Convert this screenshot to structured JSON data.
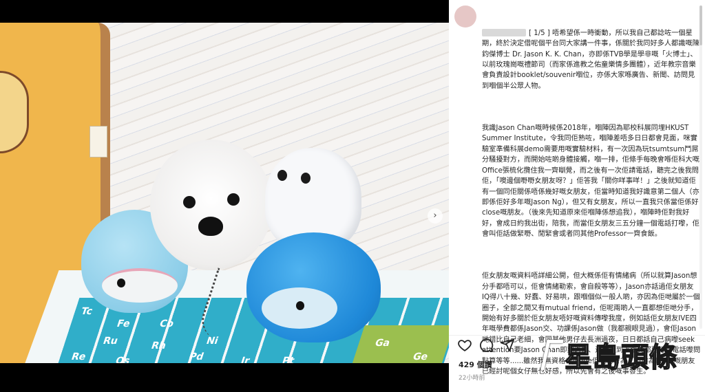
{
  "post": {
    "caption_paragraphs": [
      "[ 1/5 ] 唔希望係一時衝動，所以我自己都諗咗一個星期，終於決定借呢個平台同大家講一件事，係關於我同好多人都識嘅陳鈞傑博士 Dr. Jason K. K. Chan，亦即係TVB學是學非嘅「火博士」、以前玫瑰崗嘅禮節司（而家係進教之佑童樂情多團體），近年教宗音樂會負責設計booklet/souvenir嗰位，亦係大家喺廣告、新聞、訪問見到嗰個半公眾人物。",
      "我識Jason Chan嘅時候係2018年，嗰陣因為耶校科展同埋HKUST Summer Institute，令我同佢熟咗，嗰陣差唔多日日都會見面，咪實驗室準備科展demo需要用嘅實驗材料，有一次因為玩tsumtsum鬥屌分騷擾對方，而開始咗啲身體接觸，嗰一排，佢條手每晚會喺佢科大嘅Office張梳化攬住我一齊瞓覺，而之後有一次佢請電話，聽完之後我問佢，「噢邊個嘢嘢女朋友呀？」佢答我「關你咩事咩！」之後就知道佢有一個同佢關係唔係幾好嘅女朋友，佢當時知道我好識意第二個人（亦即係佢好多年嘅Jason Ng），但又有女朋友，所以一直我只係當佢係好close嘅朋友。（後來先知道原來佢嗰陣係想追我），嗰陣時佢對我好好，會成日約我出街，陪我，而當佢女朋友三五分鐘一個電話打嚟，佢會叫佢話做緊嘢、閒緊會或者同其他Professor一齊食飯。",
      "佢女朋友嘅資料唔詳細公開，但大概係佢有情緒病（所以就算Jason想分手都唔可以，佢會情緒勒索，會自殺等等），Jason亦話過佢女朋友IQ得八十幾、好蠢、好易哄，跟嗰個似一般人啲，亦因為佢哋屬於一個圈子，全部之間又有mutual friend，佢呢兩啲人一直都想佢哋分手，開始有好多關於佢女朋友唔好嘅資料傳嚟我度，例如話佢女朋友IVE四年嘅學費都係Jason交、功課係Jason做（我都親眼見過），會佢Jason哋錯比自己老細，會同其他男仔去長洲過夜，日日都話自己病嚟seek attention要Jason Chan即刻過去、連食飯到上張凳都要打個電話嚟問點算等等......雖然我無資格去judge佢哋啲行為，但作為Jason嘅朋友已經討呢個女仔無乜好感，所以先會有之後嘅事發生。"
    ],
    "likes": "429 個讚",
    "time": "22小時前",
    "carousel_next": "›"
  },
  "photo": {
    "tile_labels": [
      "Tc",
      "Fe",
      "Co",
      "Ni",
      "Ru",
      "Rh",
      "Pd",
      "Re",
      "Os",
      "Ir",
      "Pt",
      "Ga",
      "Ge"
    ]
  },
  "watermark": {
    "text": "星島頭條"
  },
  "colors": {
    "text": "#262626",
    "muted": "#8e8e8e",
    "photo_bg": "#000000"
  }
}
